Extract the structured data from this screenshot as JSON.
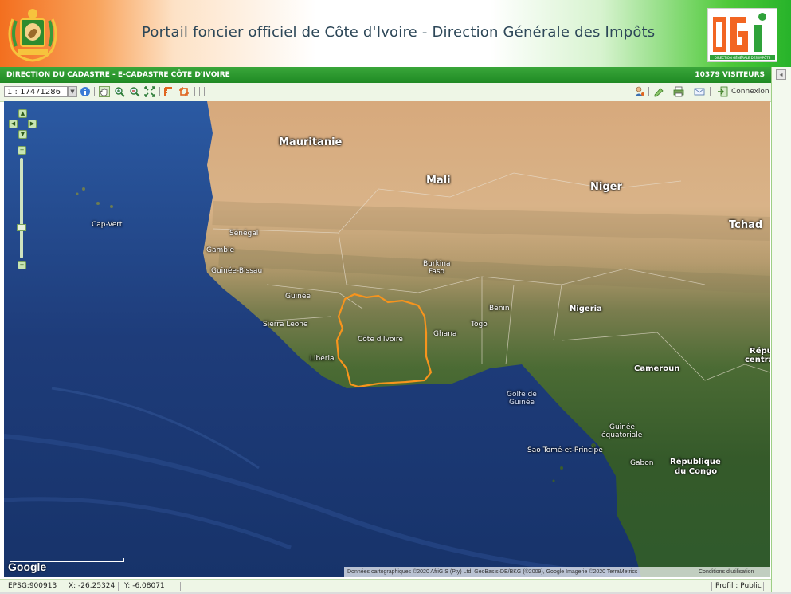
{
  "header": {
    "title": "Portail foncier officiel de Côte d'Ivoire - Direction Générale des Impôts",
    "emblem_icon": "ivory-coast-coat-of-arms",
    "logo_letters": "DGI",
    "logo_caption": "DIRECTION GÉNÉRALE DES IMPÔTS"
  },
  "titlebar": {
    "left": "DIRECTION DU CADASTRE - E-CADASTRE CÔTE D'IVOIRE",
    "right": "10379 VISITEURS"
  },
  "toolbar": {
    "scale_value": "1 : 17471286",
    "connexion_label": "Connexion",
    "icons": [
      "info-icon",
      "pan-hand-icon",
      "zoom-in-icon",
      "zoom-out-icon",
      "full-extent-icon",
      "measure-icon",
      "select-icon",
      "user-icon",
      "edit-icon",
      "print-icon",
      "mail-icon",
      "login-icon"
    ]
  },
  "map": {
    "labels": {
      "mauritanie": "Mauritanie",
      "mali": "Mali",
      "niger": "Niger",
      "tchad": "Tchad",
      "cap_vert": "Cap-Vert",
      "senegal": "Sénégal",
      "gambie": "Gambie",
      "guinee_bissau": "Guinée-Bissau",
      "guinee": "Guinée",
      "sierra_leone": "Sierra Leone",
      "liberia": "Libéria",
      "cote_divoire": "Côte d'Ivoire",
      "burkina_faso_1": "Burkina",
      "burkina_faso_2": "Faso",
      "ghana": "Ghana",
      "togo": "Togo",
      "benin": "Bénin",
      "nigeria": "Nigeria",
      "cameroun": "Cameroun",
      "golfe_1": "Golfe de",
      "golfe_2": "Guinée",
      "guinee_eq_1": "Guinée",
      "guinee_eq_2": "équatoriale",
      "sao_tome": "Sao Tomé-et-Principe",
      "gabon": "Gabon",
      "rep_congo_1": "République",
      "rep_congo_2": "du Congo",
      "rep_centrafrique_1": "Répu",
      "rep_centrafrique_2": "centra"
    },
    "google_logo": "Google",
    "attribution": "Données cartographiques ©2020 AfriGIS (Pty) Ltd, GeoBasis-DE/BKG (©2009), Google Imagerie ©2020 TerraMetrics",
    "terms": "Conditions d'utilisation",
    "highlight_color": "#f7941d"
  },
  "statusbar": {
    "epsg": "EPSG:900913",
    "x": "X: -26.25324",
    "y": "Y: -6.08071",
    "profile": "Profil : Public"
  },
  "colors": {
    "header_orange": "#f36f1f",
    "header_green": "#27b32a",
    "bar_green": "#1f8a24",
    "ocean": "#213f7a"
  }
}
